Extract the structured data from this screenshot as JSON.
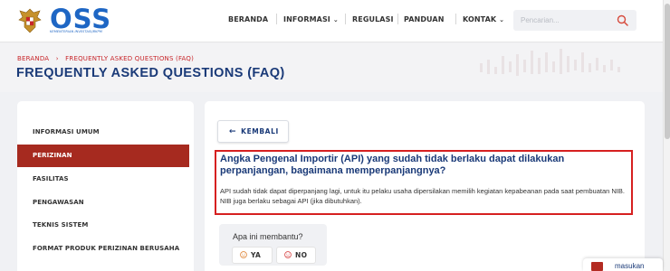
{
  "header": {
    "logo_text": "OSS",
    "logo_subtitle": "KEMENTERIAN INVESTASI/BKPM",
    "nav": [
      {
        "label": "BERANDA",
        "has_caret": false
      },
      {
        "label": "INFORMASI",
        "has_caret": true
      },
      {
        "label": "REGULASI",
        "has_caret": false
      },
      {
        "label": "PANDUAN",
        "has_caret": false
      },
      {
        "label": "KONTAK",
        "has_caret": true
      }
    ],
    "search_placeholder": "Pencarian...",
    "caret_glyph": "⌄"
  },
  "breadcrumb": {
    "home": "BERANDA",
    "separator": "›",
    "current": "FREQUENTLY ASKED QUESTIONS (FAQ)"
  },
  "page_title": "FREQUENTLY ASKED QUESTIONS (FAQ)",
  "sidebar": {
    "items": [
      {
        "label": "INFORMASI UMUM",
        "active": false
      },
      {
        "label": "PERIZINAN",
        "active": true
      },
      {
        "label": "FASILITAS",
        "active": false
      },
      {
        "label": "PENGAWASAN",
        "active": false
      },
      {
        "label": "TEKNIS SISTEM",
        "active": false
      },
      {
        "label": "FORMAT PRODUK PERIZINAN BERUSAHA",
        "active": false
      }
    ]
  },
  "content": {
    "back_arrow": "←",
    "back_label": "KEMBALI",
    "question": "Angka Pengenal Importir (API) yang sudah tidak berlaku dapat dilakukan perpanjangan, bagaimana memperpanjangnya?",
    "answer": "API sudah tidak dapat diperpanjang lagi, untuk itu pelaku usaha dipersilakan memilih kegiatan kepabeanan pada saat pembuatan NIB. NIB juga berlaku sebagai API (jika dibutuhkan).",
    "helpful_question": "Apa ini membantu?",
    "yes_label": "YA",
    "no_label": "NO"
  },
  "feedback": {
    "label": "masukan"
  },
  "colors": {
    "brand_blue": "#1e66c4",
    "title_navy": "#1a3a78",
    "active_red": "#a62a1f",
    "highlight_red": "#d62020",
    "yes_orange": "#e0883c",
    "no_red": "#d84a4a"
  },
  "icons": {
    "logo": "garuda-emblem-icon",
    "search": "search-icon",
    "back": "arrow-left-icon",
    "yes": "smile-icon",
    "no": "frown-icon",
    "feedback": "chat-icon"
  }
}
